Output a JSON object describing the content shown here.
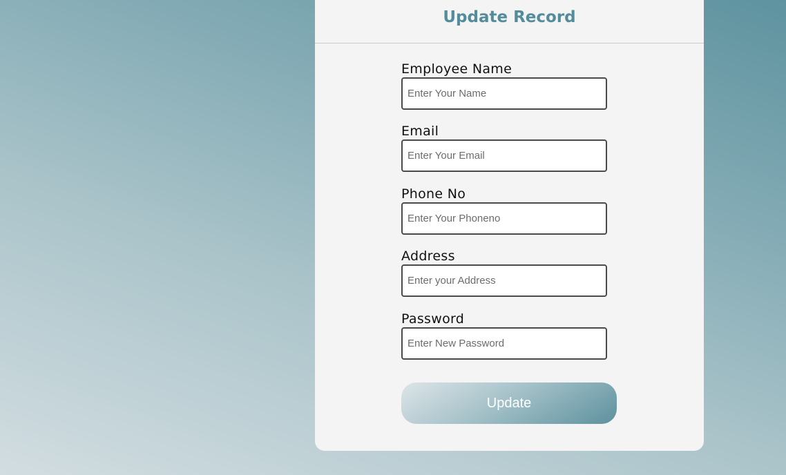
{
  "form": {
    "title": "Update Record",
    "fields": [
      {
        "label": "Employee Name",
        "placeholder": "Enter Your Name",
        "value": ""
      },
      {
        "label": "Email",
        "placeholder": "Enter Your Email",
        "value": ""
      },
      {
        "label": "Phone No",
        "placeholder": "Enter Your Phoneno",
        "value": ""
      },
      {
        "label": "Address",
        "placeholder": "Enter your Address",
        "value": ""
      },
      {
        "label": "Password",
        "placeholder": "Enter New Password",
        "value": ""
      }
    ],
    "submit_label": "Update"
  },
  "colors": {
    "accent": "#538c9a",
    "card_background": "#f4f4f4",
    "page_gradient_start": "#d2dde1",
    "page_gradient_end": "#5e939f"
  }
}
